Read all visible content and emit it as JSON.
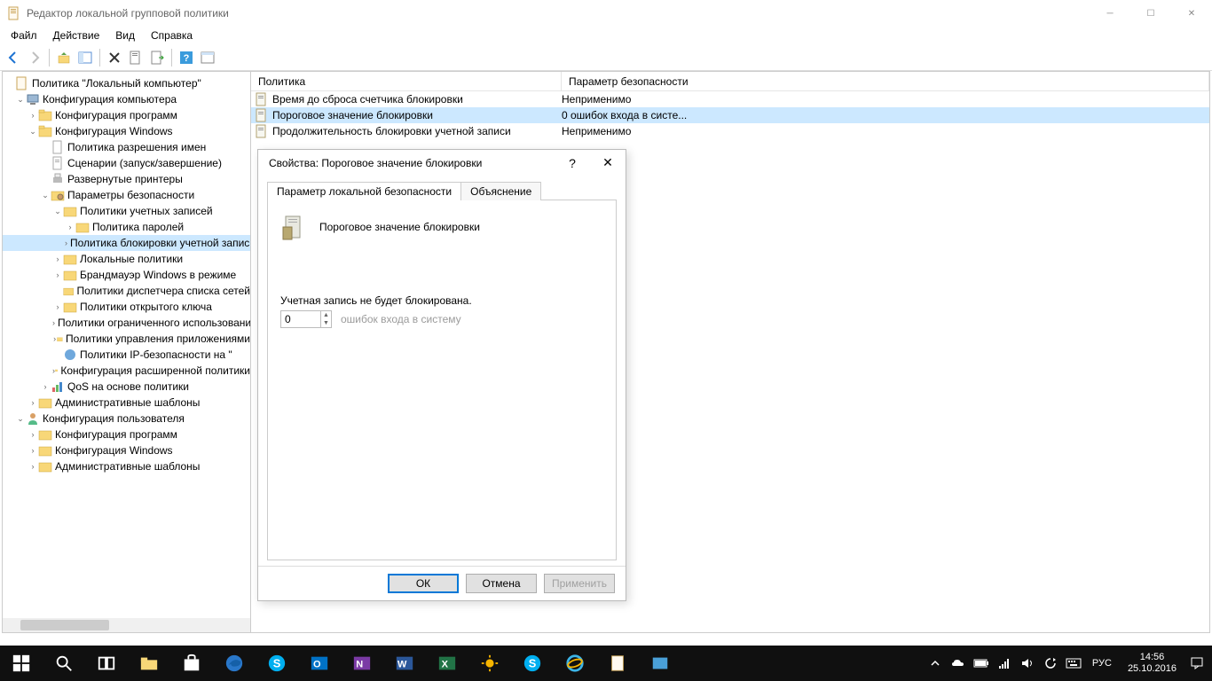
{
  "window": {
    "title": "Редактор локальной групповой политики"
  },
  "menu": {
    "file": "Файл",
    "action": "Действие",
    "view": "Вид",
    "help": "Справка"
  },
  "tree": {
    "root": "Политика \"Локальный компьютер\"",
    "computer_config": "Конфигурация компьютера",
    "software_config": "Конфигурация программ",
    "windows_config": "Конфигурация Windows",
    "name_resolution": "Политика разрешения имен",
    "scripts": "Сценарии (запуск/завершение)",
    "deployed_printers": "Развернутые принтеры",
    "security_settings": "Параметры безопасности",
    "account_policies": "Политики учетных записей",
    "password_policy": "Политика паролей",
    "lockout_policy": "Политика блокировки учетной записи",
    "local_policies": "Локальные политики",
    "firewall": "Брандмауэр Windows в режиме",
    "nlm_policies": "Политики диспетчера списка сетей",
    "public_key": "Политики открытого ключа",
    "software_restriction": "Политики ограниченного использования",
    "appcontrol": "Политики управления приложениями",
    "ipsec": "Политики IP-безопасности на \"",
    "advanced_audit": "Конфигурация расширенной политики",
    "qos": "QoS на основе политики",
    "admin_templates_c": "Административные шаблоны",
    "user_config": "Конфигурация пользователя",
    "software_config_u": "Конфигурация программ",
    "windows_config_u": "Конфигурация Windows",
    "admin_templates_u": "Административные шаблоны"
  },
  "list": {
    "header_policy": "Политика",
    "header_security": "Параметр безопасности",
    "rows": [
      {
        "name": "Время до сброса счетчика блокировки",
        "value": "Неприменимо"
      },
      {
        "name": "Пороговое значение блокировки",
        "value": "0 ошибок входа в систе..."
      },
      {
        "name": "Продолжительность блокировки учетной записи",
        "value": "Неприменимо"
      }
    ]
  },
  "dialog": {
    "title": "Свойства: Пороговое значение блокировки",
    "tab_local": "Параметр локальной безопасности",
    "tab_explain": "Объяснение",
    "policy_name": "Пороговое значение блокировки",
    "not_locked": "Учетная запись не будет блокирована.",
    "spinner_value": "0",
    "hint": "ошибок входа в систему",
    "ok": "ОК",
    "cancel": "Отмена",
    "apply": "Применить"
  },
  "tray": {
    "lang": "РУС",
    "time": "14:56",
    "date": "25.10.2016"
  }
}
